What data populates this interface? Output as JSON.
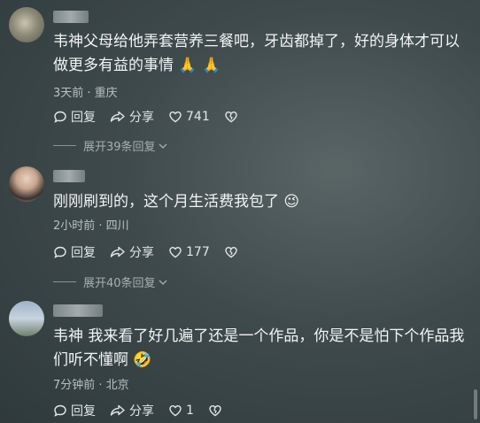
{
  "comments": [
    {
      "text": "韦神父母给他弄套营养三餐吧，牙齿都掉了，好的身体才可以做更多有益的事情 🙏 🙏",
      "meta": "3天前 · 重庆",
      "reply_label": "回复",
      "share_label": "分享",
      "like_count": "741",
      "expand_label": "展开39条回复"
    },
    {
      "text": "刚刚刷到的，这个月生活费我包了 😉",
      "meta": "2小时前 · 四川",
      "reply_label": "回复",
      "share_label": "分享",
      "like_count": "177",
      "expand_label": "展开40条回复"
    },
    {
      "text": "韦神 我来看了好几遍了还是一个作品，你是不是怕下个作品我们听不懂啊 🤣",
      "meta": "7分钟前 · 北京",
      "reply_label": "回复",
      "share_label": "分享",
      "like_count": "1"
    }
  ],
  "icons": {
    "reply": "reply-bubble-icon",
    "share": "share-arrow-icon",
    "like": "heart-icon",
    "dislike": "broken-heart-icon",
    "expand": "chevron-down-icon"
  }
}
